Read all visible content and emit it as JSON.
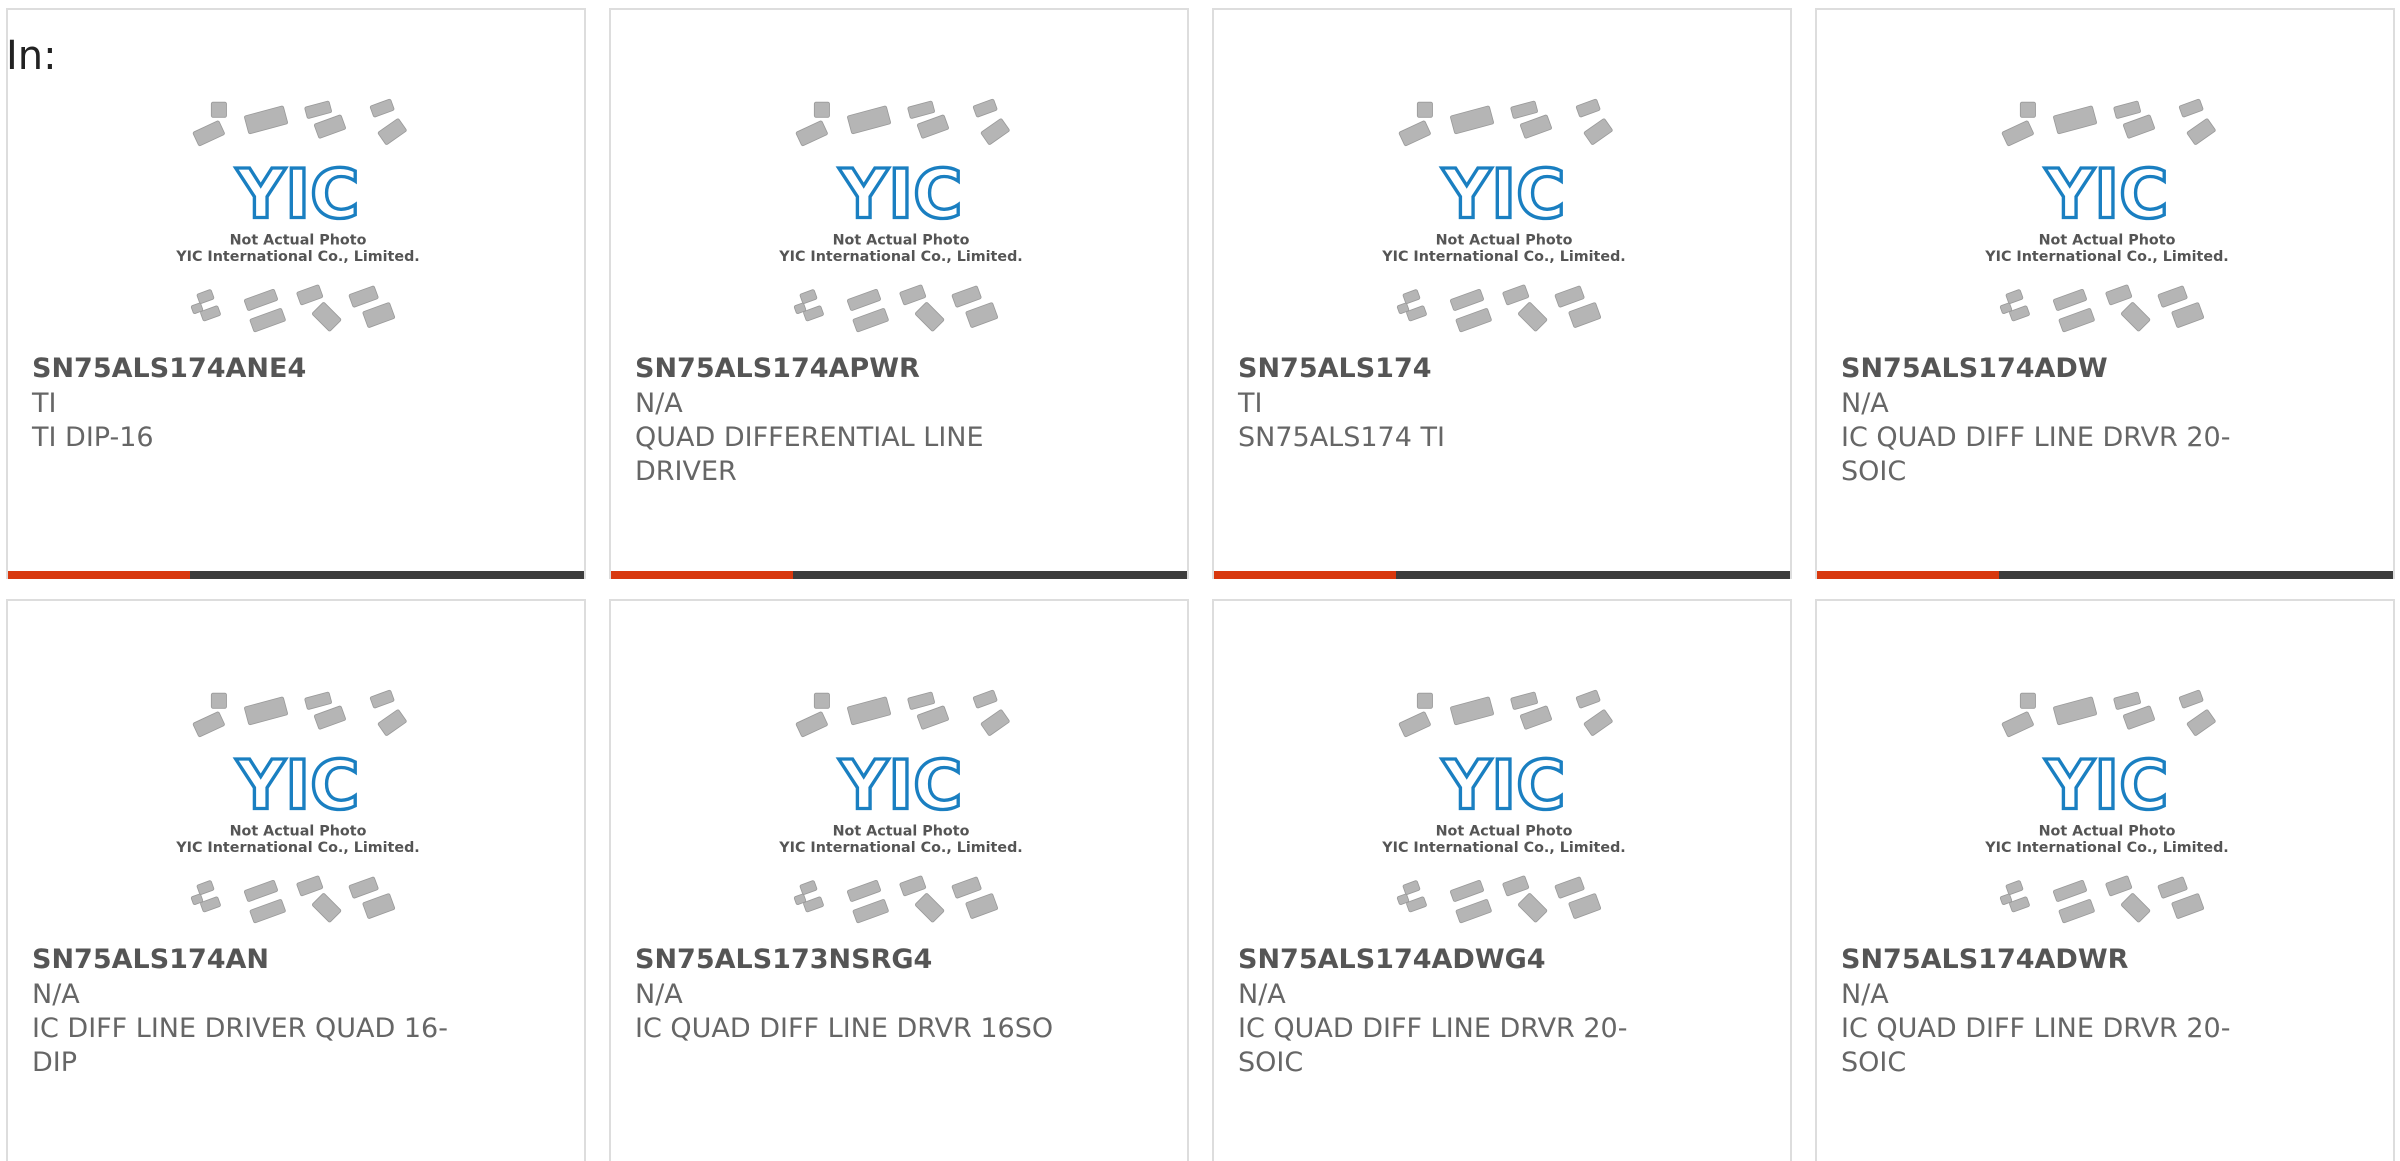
{
  "section": {
    "label": "In:"
  },
  "photo": {
    "caption_line1": "Not Actual Photo",
    "caption_line2": "YIC International Co., Limited.",
    "logo_text": "YIC",
    "logo_color": "#1a7fc1",
    "chip_color": "#b5b5b5"
  },
  "colors": {
    "accent": "#d8380e",
    "bar": "#3c3c3c",
    "border": "#dddddd",
    "text": "#666666"
  },
  "products": [
    {
      "part": "SN75ALS174ANE4",
      "maker": "TI",
      "desc": "TI DIP-16"
    },
    {
      "part": "SN75ALS174APWR",
      "maker": "N/A",
      "desc": "QUAD DIFFERENTIAL LINE DRIVER"
    },
    {
      "part": "SN75ALS174",
      "maker": "TI",
      "desc": "SN75ALS174 TI"
    },
    {
      "part": "SN75ALS174ADW",
      "maker": "N/A",
      "desc": "IC QUAD DIFF LINE DRVR 20-SOIC"
    },
    {
      "part": "SN75ALS174AN",
      "maker": "N/A",
      "desc": "IC DIFF LINE DRIVER QUAD 16-DIP"
    },
    {
      "part": "SN75ALS173NSRG4",
      "maker": "N/A",
      "desc": "IC QUAD DIFF LINE DRVR 16SO"
    },
    {
      "part": "SN75ALS174ADWG4",
      "maker": "N/A",
      "desc": "IC QUAD DIFF LINE DRVR 20-SOIC"
    },
    {
      "part": "SN75ALS174ADWR",
      "maker": "N/A",
      "desc": "IC QUAD DIFF LINE DRVR 20-SOIC"
    }
  ]
}
